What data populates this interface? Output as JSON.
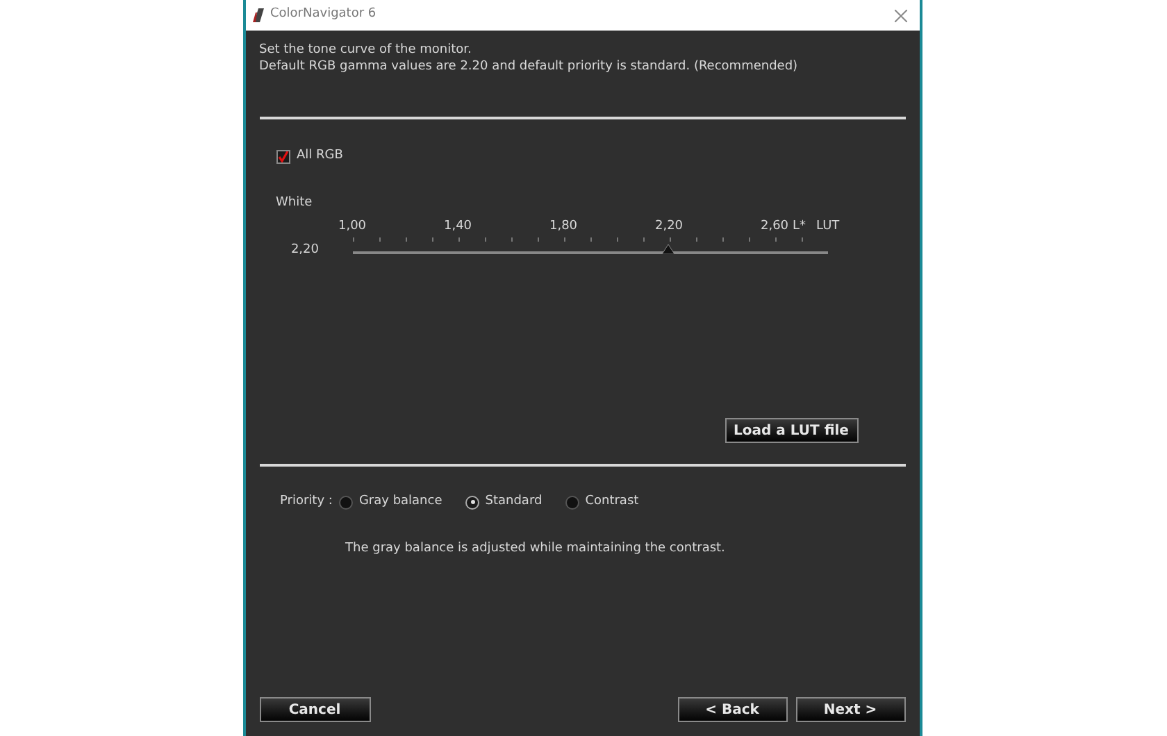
{
  "window": {
    "title": "ColorNavigator 6"
  },
  "instructions": [
    "Set the tone curve of the monitor.",
    "Default RGB gamma values are 2.20 and default priority is standard. (Recommended)"
  ],
  "all_rgb": {
    "label": "All RGB",
    "checked": true
  },
  "slider": {
    "label": "White",
    "reading": "2,20",
    "ticks": [
      "1,00",
      "1,40",
      "1,80",
      "2,20",
      "2,60"
    ],
    "end_labels": [
      "L*",
      "LUT"
    ],
    "level": 0.664
  },
  "load_button": "Load a LUT file",
  "priority": {
    "label": "Priority :",
    "options": [
      {
        "label": "Gray balance",
        "selected": false
      },
      {
        "label": "Standard",
        "selected": true
      },
      {
        "label": "Contrast",
        "selected": false
      }
    ]
  },
  "description": "The gray balance is adjusted while maintaining the contrast.",
  "buttons": {
    "cancel": "Cancel",
    "back": "< Back",
    "next": "Next >"
  }
}
